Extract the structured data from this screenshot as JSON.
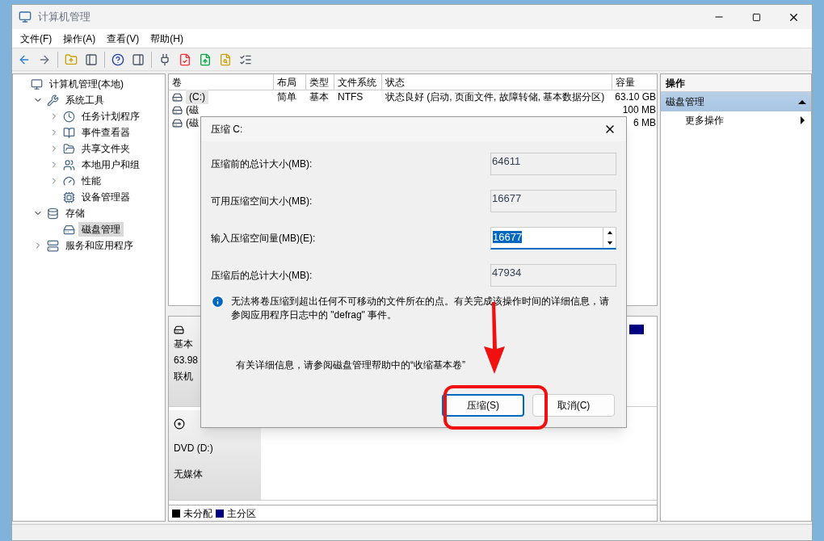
{
  "window": {
    "title": "计算机管理"
  },
  "menu": [
    "文件(F)",
    "操作(A)",
    "查看(V)",
    "帮助(H)"
  ],
  "tree": [
    {
      "label": "计算机管理(本地)",
      "kind": "computer",
      "selected": false,
      "children": [
        {
          "label": "系统工具",
          "kind": "tools",
          "expanded": true,
          "selected": false,
          "children": [
            {
              "label": "任务计划程序",
              "kind": "clock",
              "expanded": false,
              "selected": false
            },
            {
              "label": "事件查看器",
              "kind": "log",
              "expanded": false,
              "selected": false
            },
            {
              "label": "共享文件夹",
              "kind": "folder",
              "expanded": false,
              "selected": false
            },
            {
              "label": "本地用户和组",
              "kind": "users",
              "expanded": false,
              "selected": false
            },
            {
              "label": "性能",
              "kind": "gauge",
              "expanded": false,
              "selected": false
            },
            {
              "label": "设备管理器",
              "kind": "device",
              "selected": false
            }
          ]
        },
        {
          "label": "存储",
          "kind": "storage",
          "expanded": true,
          "selected": false,
          "children": [
            {
              "label": "磁盘管理",
              "kind": "disk",
              "selected": true
            }
          ]
        },
        {
          "label": "服务和应用程序",
          "kind": "services",
          "expanded": false,
          "selected": false
        }
      ]
    }
  ],
  "table": {
    "columns": [
      "卷",
      "布局",
      "类型",
      "文件系统",
      "状态",
      "容量"
    ],
    "rows": [
      {
        "selected": true,
        "cells": [
          "(C:)",
          "简单",
          "基本",
          "NTFS",
          "状态良好 (启动, 页面文件, 故障转储, 基本数据分区)",
          "63.10 GB"
        ]
      },
      {
        "selected": false,
        "cells": [
          "(磁",
          "",
          "",
          "",
          "",
          "100 MB"
        ]
      },
      {
        "selected": false,
        "cells": [
          "(磁",
          "",
          "",
          "",
          "",
          "6 MB"
        ]
      }
    ]
  },
  "disks": [
    {
      "kind": "disk",
      "lines": [
        "基本",
        "63.98",
        "联机"
      ]
    },
    {
      "kind": "cdrom",
      "lines": [
        "DVD (D:)",
        "无媒体"
      ]
    }
  ],
  "legend": [
    {
      "label": "未分配",
      "color": "#000000"
    },
    {
      "label": "主分区",
      "color": "#000080"
    }
  ],
  "actions": {
    "title": "操作",
    "section": "磁盘管理",
    "items": [
      "更多操作"
    ]
  },
  "dialog": {
    "title": "压缩 C:",
    "fields": [
      {
        "label": "压缩前的总计大小(MB):",
        "value": "64611",
        "kind": "readonly"
      },
      {
        "label": "可用压缩空间大小(MB):",
        "value": "16677",
        "kind": "readonly"
      },
      {
        "label": "输入压缩空间量(MB)(E):",
        "value": "16677",
        "kind": "spin"
      },
      {
        "label": "压缩后的总计大小(MB):",
        "value": "47934",
        "kind": "readonly"
      }
    ],
    "note": "无法将卷压缩到超出任何不可移动的文件所在的点。有关完成该操作时间的详细信息，请参阅应用程序日志中的 \"defrag\" 事件。",
    "help": "有关详细信息，请参阅磁盘管理帮助中的“收缩基本卷”",
    "buttons": [
      {
        "label": "压缩(S)",
        "default": true
      },
      {
        "label": "取消(C)",
        "default": false
      }
    ]
  }
}
